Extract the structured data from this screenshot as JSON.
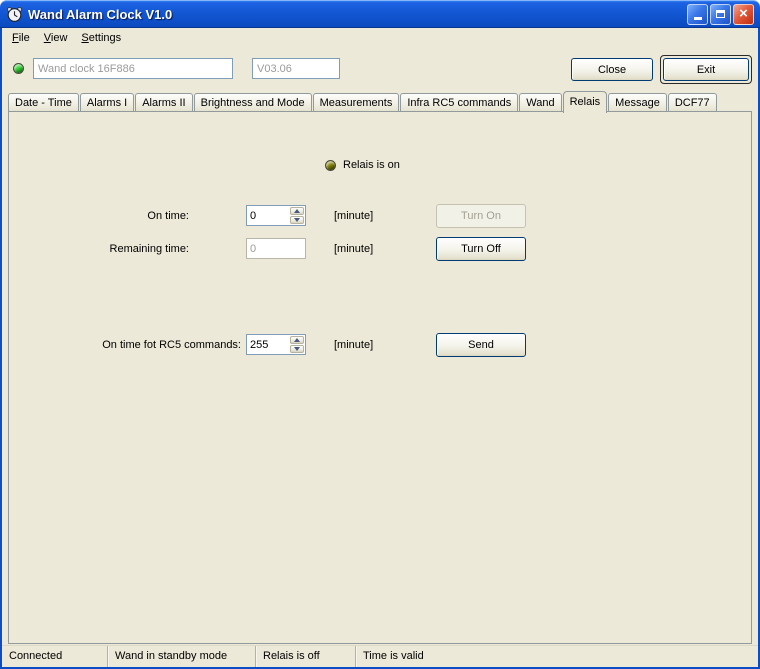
{
  "window": {
    "title": "Wand Alarm Clock V1.0"
  },
  "menu": {
    "items": [
      {
        "label": "File"
      },
      {
        "label": "View"
      },
      {
        "label": "Settings"
      }
    ]
  },
  "toolbar": {
    "status_led_color": "#2ED32E",
    "device_field_value": "Wand clock 16F886",
    "version_field_value": "V03.06",
    "close_button_label": "Close",
    "exit_button_label": "Exit"
  },
  "tabs": [
    {
      "label": "Date - Time",
      "selected": false
    },
    {
      "label": "Alarms I",
      "selected": false
    },
    {
      "label": "Alarms II",
      "selected": false
    },
    {
      "label": "Brightness and Mode",
      "selected": false
    },
    {
      "label": "Measurements",
      "selected": false
    },
    {
      "label": "Infra RC5 commands",
      "selected": false
    },
    {
      "label": "Wand",
      "selected": false
    },
    {
      "label": "Relais",
      "selected": true
    },
    {
      "label": "Message",
      "selected": false
    },
    {
      "label": "DCF77",
      "selected": false
    }
  ],
  "relais_panel": {
    "led": {
      "label": "Relais is on",
      "color": "#7F7F00"
    },
    "on_time": {
      "label": "On time:",
      "value": "0",
      "unit": "[minute]"
    },
    "remaining_time": {
      "label": "Remaining time:",
      "value": "0",
      "unit": "[minute]"
    },
    "rc5_on_time": {
      "label": "On time fot RC5 commands:",
      "value": "255",
      "unit": "[minute]"
    },
    "turn_on_button": "Turn On",
    "turn_off_button": "Turn Off",
    "send_button": "Send"
  },
  "statusbar": {
    "panels": [
      {
        "text": "Connected"
      },
      {
        "text": "Wand in standby mode"
      },
      {
        "text": "Relais is off"
      },
      {
        "text": "Time is valid"
      }
    ]
  }
}
